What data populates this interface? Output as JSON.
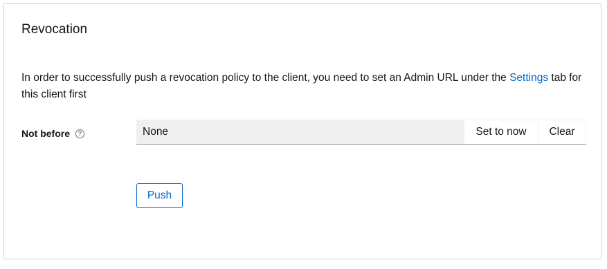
{
  "section": {
    "title": "Revocation"
  },
  "info": {
    "text_before": "In order to successfully push a revocation policy to the client, you need to set an Admin URL under the ",
    "link_label": "Settings",
    "text_after": " tab for this client first"
  },
  "not_before": {
    "label": "Not before",
    "help_icon": "help-circle-icon",
    "value": "None",
    "set_to_now_label": "Set to now",
    "clear_label": "Clear"
  },
  "actions": {
    "push_label": "Push"
  },
  "colors": {
    "accent": "#0066cc",
    "border": "#d2d2d2",
    "input_bg": "#f0f0f0"
  }
}
